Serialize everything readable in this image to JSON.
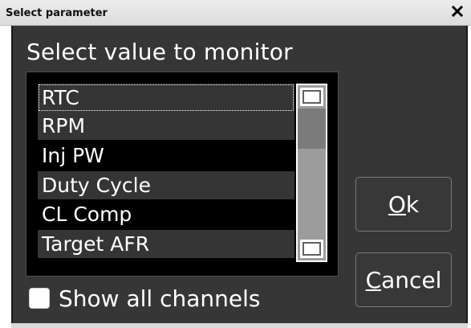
{
  "window": {
    "title": "Select parameter",
    "close_icon": "close-icon"
  },
  "dialog": {
    "heading": "Select value to monitor",
    "list": {
      "items": [
        {
          "label": "RTC",
          "selected": false,
          "focused": true
        },
        {
          "label": "RPM",
          "selected": false,
          "focused": false
        },
        {
          "label": "Inj PW",
          "selected": false,
          "focused": false
        },
        {
          "label": "Duty Cycle",
          "selected": false,
          "focused": false
        },
        {
          "label": "CL Comp",
          "selected": false,
          "focused": false
        },
        {
          "label": "Target AFR",
          "selected": false,
          "focused": false
        }
      ],
      "scroll_position": 0.12
    },
    "buttons": {
      "ok_mnemonic": "O",
      "ok_rest": "k",
      "cancel_mnemonic": "C",
      "cancel_rest": "ancel"
    },
    "show_all": {
      "label": "Show all channels",
      "checked": false
    }
  },
  "colors": {
    "panel": "#363636",
    "list_background": "#000000",
    "list_alt_row": "#353535",
    "text": "#ffffff",
    "scrollbar_track": "#9c9c9c"
  }
}
